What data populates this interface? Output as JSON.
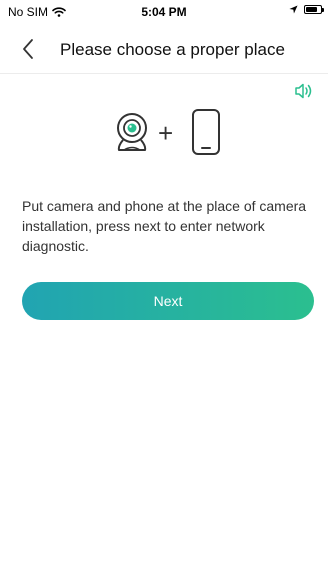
{
  "status_bar": {
    "carrier": "No SIM",
    "time": "5:04 PM",
    "icons": [
      "wifi-icon",
      "location-arrow-icon",
      "battery-icon"
    ]
  },
  "nav": {
    "back_icon": "chevron-left-icon",
    "title": "Please choose a proper place"
  },
  "speaker": {
    "icon": "speaker-icon"
  },
  "illustration": {
    "camera_icon": "camera-icon",
    "plus": "+",
    "phone_icon": "phone-icon"
  },
  "instructions": "Put camera and phone at the place of camera installation, press next to enter network diagnostic.",
  "next_button": {
    "label": "Next"
  },
  "colors": {
    "accent_start": "#21a4b2",
    "accent_end": "#2bbf8f",
    "speaker": "#2bbf8f"
  }
}
